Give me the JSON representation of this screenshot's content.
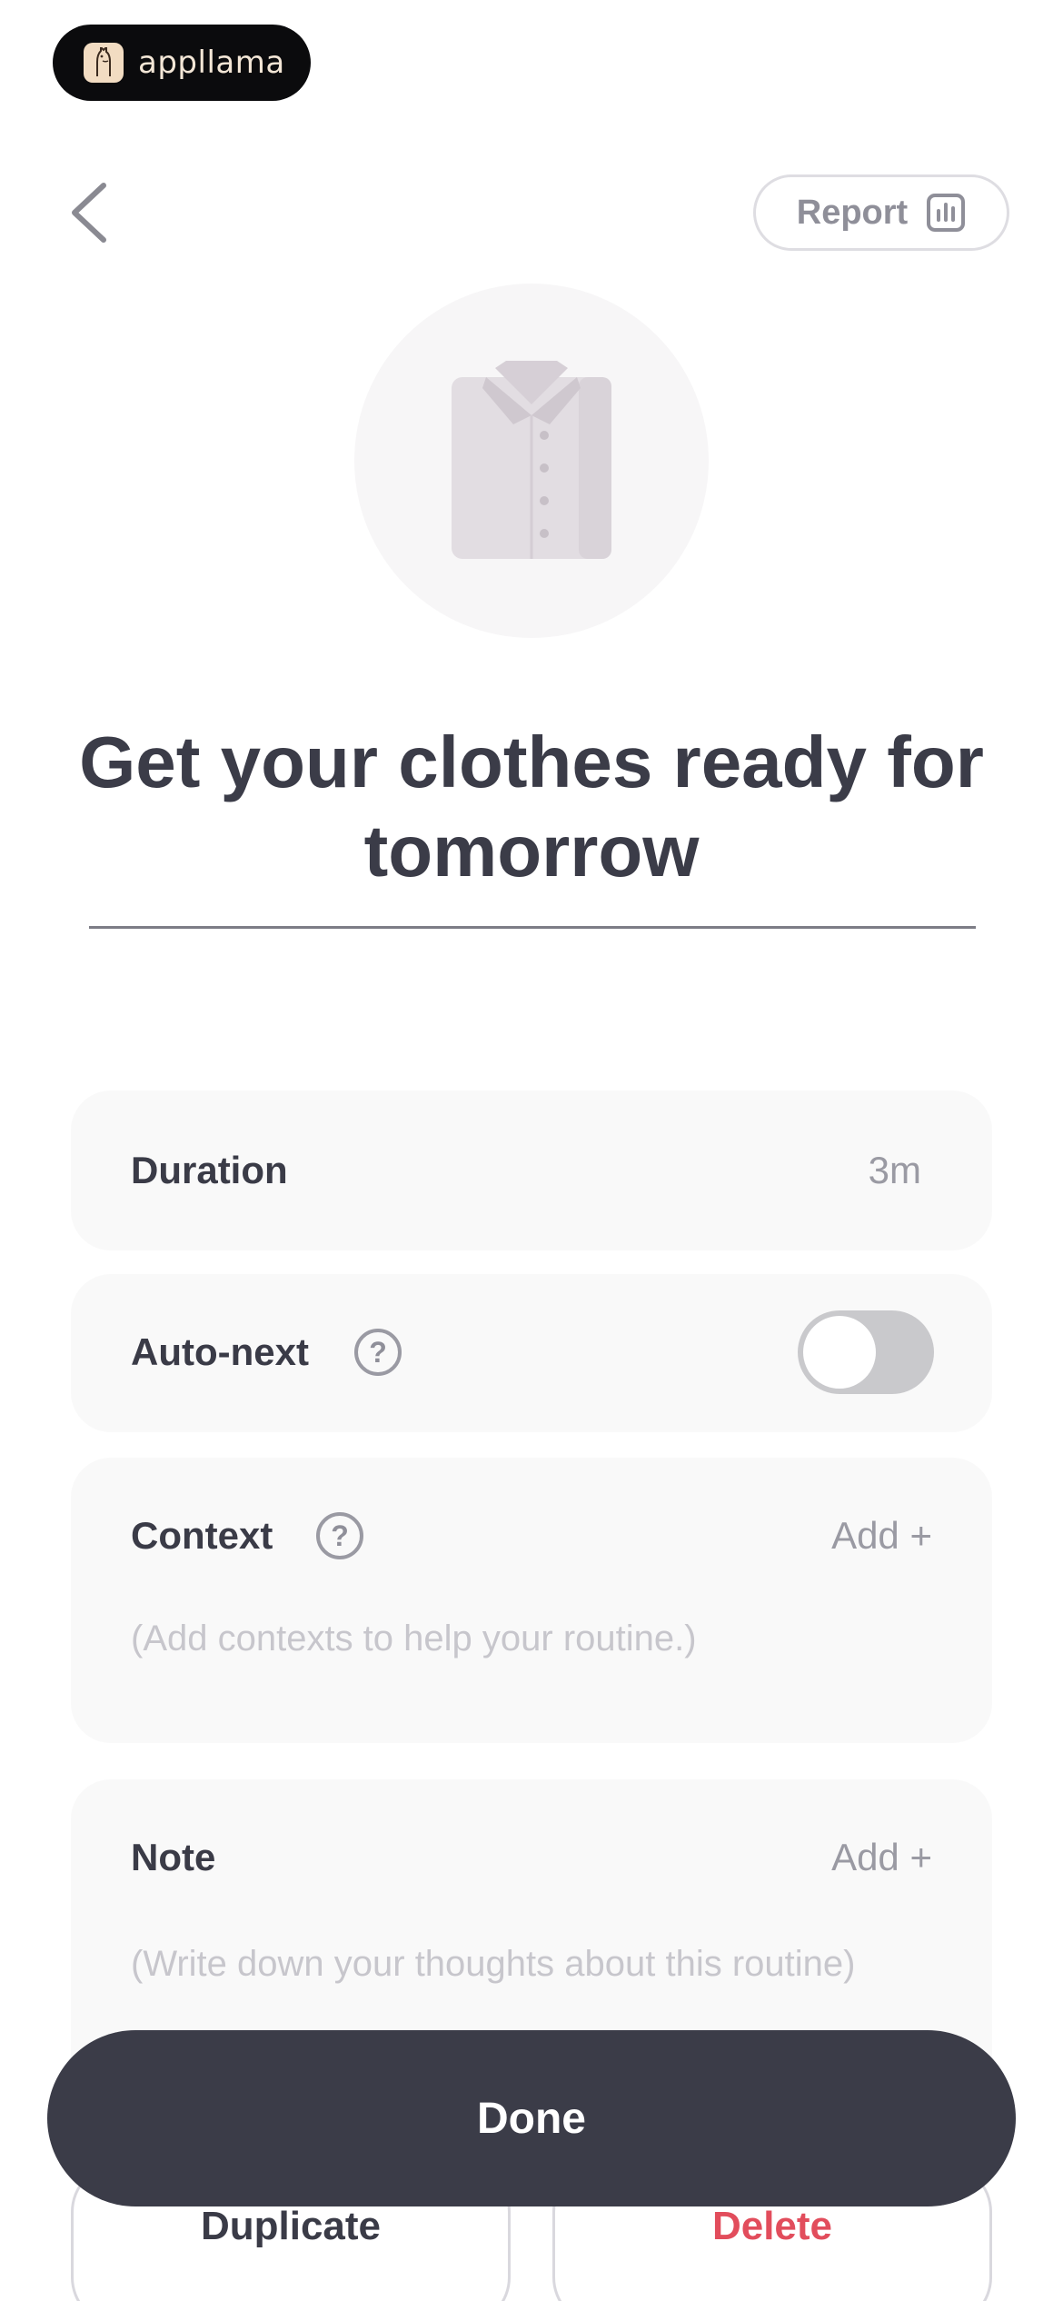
{
  "brand": {
    "name": "appllama"
  },
  "header": {
    "back_icon": "chevron-left-icon",
    "report_label": "Report",
    "report_icon": "bar-chart-icon"
  },
  "illustration": {
    "icon": "shirt-icon"
  },
  "title": "Get your clothes ready for tomorrow",
  "duration": {
    "label": "Duration",
    "value": "3m"
  },
  "auto_next": {
    "label": "Auto-next",
    "help": "?",
    "enabled": false
  },
  "context": {
    "label": "Context",
    "help": "?",
    "add_label": "Add +",
    "placeholder": "(Add contexts to help your routine.)"
  },
  "note": {
    "label": "Note",
    "add_label": "Add +",
    "placeholder": "(Write down your thoughts about this routine)"
  },
  "actions": {
    "done_label": "Done",
    "duplicate_label": "Duplicate",
    "delete_label": "Delete"
  },
  "colors": {
    "primary_dark": "#3b3c48",
    "danger": "#e24d5c",
    "card_bg": "#f9f9f9"
  }
}
